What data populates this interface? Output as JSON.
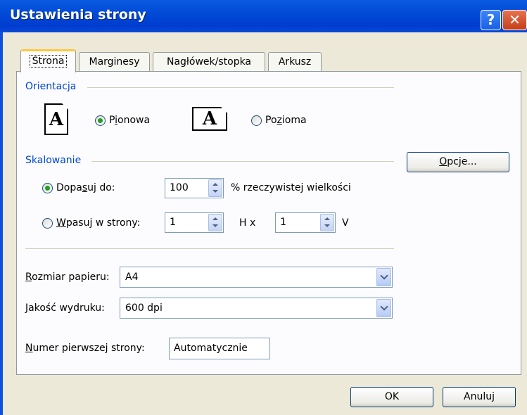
{
  "window": {
    "title": "Ustawienia strony",
    "help_label": "?",
    "close_label": "✕"
  },
  "tabs": [
    {
      "label": "Strona",
      "active": true
    },
    {
      "label": "Marginesy",
      "active": false
    },
    {
      "label": "Nagłówek/stopka",
      "active": false
    },
    {
      "label": "Arkusz",
      "active": false
    }
  ],
  "orientation": {
    "section_label": "Orientacja",
    "portrait_icon": "A",
    "landscape_icon": "A",
    "portrait_label_pre": "P",
    "portrait_label_key": "i",
    "portrait_label_post": "onowa",
    "landscape_label_pre": "Po",
    "landscape_label_key": "z",
    "landscape_label_post": "ioma",
    "selected": "Pionowa"
  },
  "scaling": {
    "section_label": "Skalowanie",
    "options_button_pre": "",
    "options_button_key": "O",
    "options_button_post": "pcje...",
    "fit_to_label_pre": "Dopa",
    "fit_to_label_key": "s",
    "fit_to_label_post": "uj do:",
    "fit_to_value": "100",
    "fit_to_suffix": "% rzeczywistej wielkości",
    "pages_label_pre": "",
    "pages_label_key": "W",
    "pages_label_post": "pasuj w strony:",
    "pages_wide_value": "1",
    "pages_wide_suffix": "H x",
    "pages_tall_value": "1",
    "pages_tall_suffix": "V",
    "selected": "Dopasuj do"
  },
  "paper_size": {
    "label_key": "R",
    "label_post": "ozmiar papieru:",
    "value": "A4"
  },
  "print_quality": {
    "label_key": "J",
    "label_post": "akość wydruku:",
    "value": "600 dpi"
  },
  "first_page": {
    "label_key": "N",
    "label_post": "umer pierwszej strony:",
    "value": "Automatycznie"
  },
  "buttons": {
    "ok": "OK",
    "cancel": "Anuluj"
  },
  "colors": {
    "titlebar": "#0049d6",
    "section_text": "#0046d5",
    "active_tab_accent": "#ffc83c",
    "radio_dot": "#21a121"
  }
}
